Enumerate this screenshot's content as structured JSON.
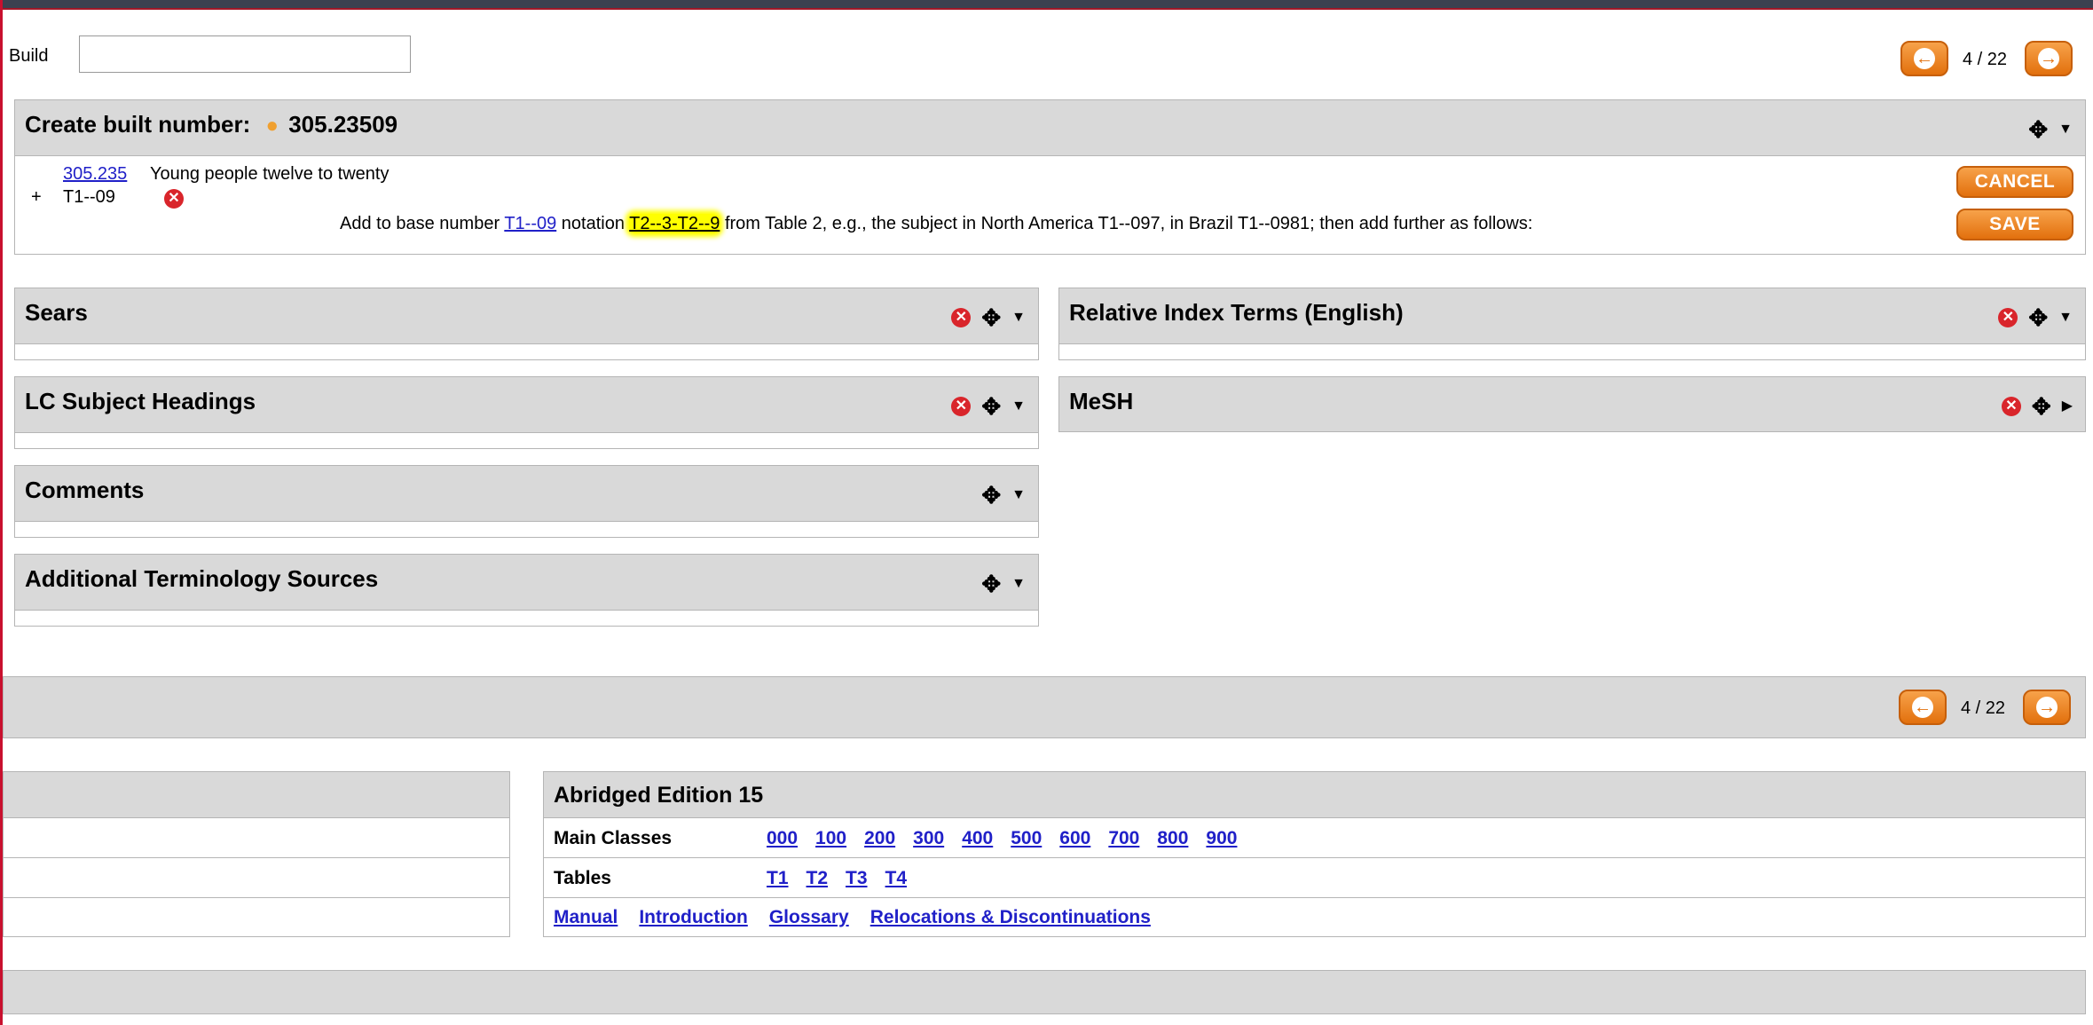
{
  "build": {
    "label": "Build",
    "value": ""
  },
  "pager_top": {
    "text": "4 / 22"
  },
  "pager_bottom": {
    "text": "4 / 22"
  },
  "create_panel": {
    "title": "Create built number:",
    "number": "305.23509",
    "base_link": "305.235",
    "base_desc": "Young people twelve to twenty",
    "plus": "+",
    "add_code": "T1--09",
    "instruction": {
      "t1": "Add to base number ",
      "link1": "T1--09",
      "t2": " notation ",
      "link2": "T2--3-T2--9",
      "t3": " from Table 2, e.g., the subject in North America T1--097, in Brazil T1--0981; then add further as follows:"
    },
    "cancel_label": "CANCEL",
    "save_label": "SAVE"
  },
  "panels": {
    "sears": "Sears",
    "relative_index": "Relative Index Terms (English)",
    "lcsh": "LC Subject Headings",
    "mesh": "MeSH",
    "comments": "Comments",
    "additional": "Additional Terminology Sources"
  },
  "abridged": {
    "title": "Abridged Edition 15",
    "main_label": "Main Classes",
    "main_classes": [
      "000",
      "100",
      "200",
      "300",
      "400",
      "500",
      "600",
      "700",
      "800",
      "900"
    ],
    "tables_label": "Tables",
    "tables": [
      "T1",
      "T2",
      "T3",
      "T4"
    ],
    "links": [
      "Manual",
      "Introduction",
      "Glossary",
      "Relocations & Discontinuations"
    ]
  },
  "icons": {
    "prev": "arrow-left-icon",
    "next": "arrow-right-icon",
    "remove": "remove-x-icon",
    "move": "move-cross-icon",
    "caret_down": "caret-down-icon",
    "caret_right": "caret-right-icon",
    "person": "person-icon"
  },
  "colors": {
    "accent": "#e2700d",
    "header_bg": "#d9d9d9",
    "link": "#2020c8",
    "highlight": "#ffff00",
    "remove": "#d9252b"
  }
}
